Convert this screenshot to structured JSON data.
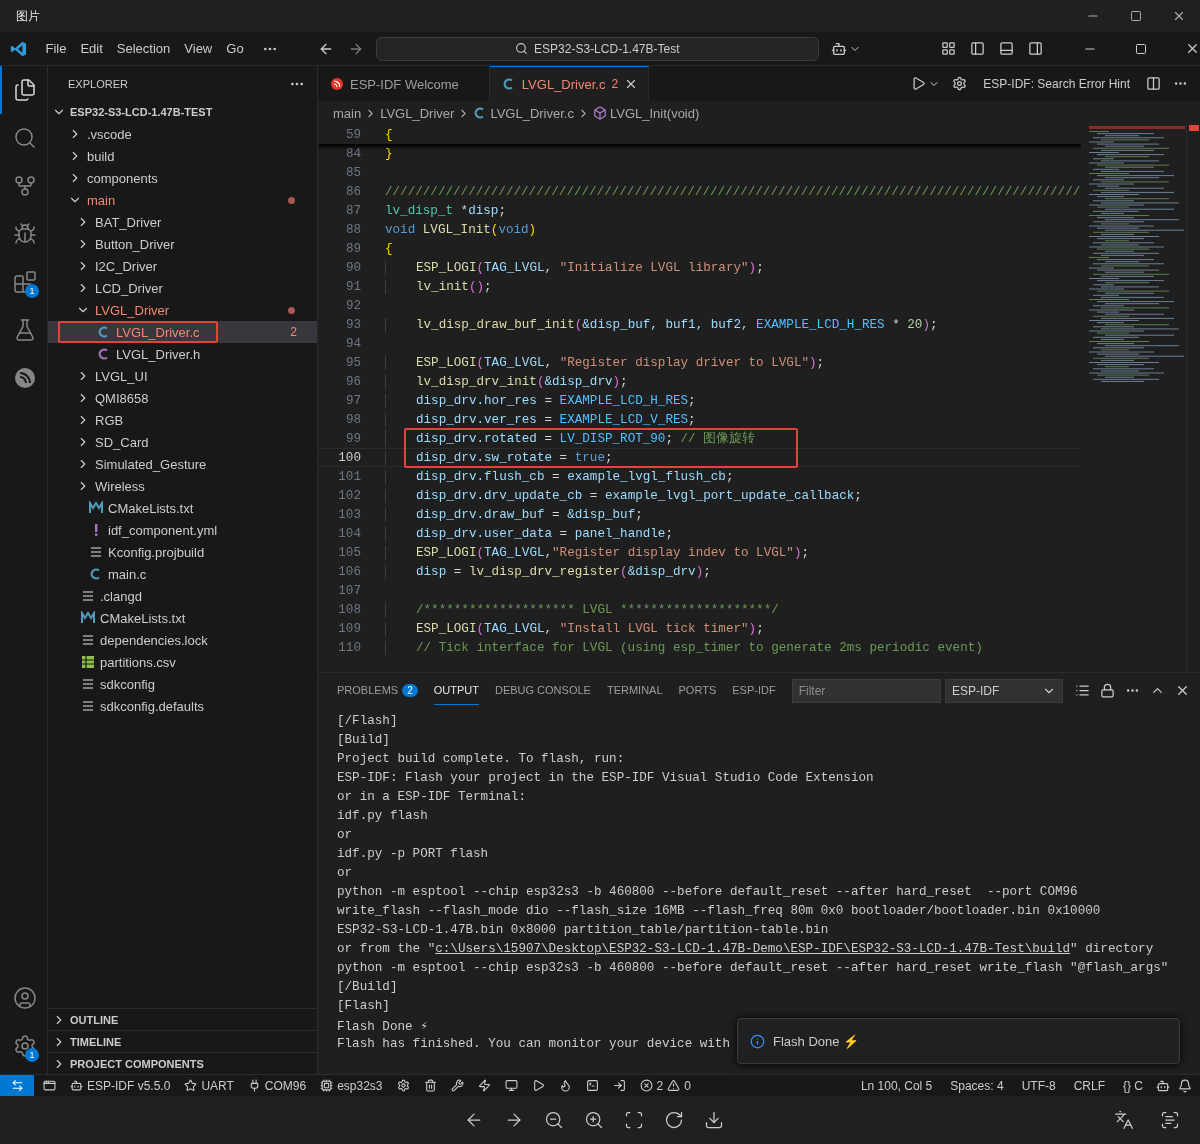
{
  "viewer": {
    "title": "图片"
  },
  "titlebar": {
    "menus": [
      "File",
      "Edit",
      "Selection",
      "View",
      "Go"
    ],
    "search": "ESP32-S3-LCD-1.47B-Test"
  },
  "activity": [
    {
      "kind": "explorer",
      "selected": true
    },
    {
      "kind": "search",
      "selected": false
    },
    {
      "kind": "source-control",
      "selected": false
    },
    {
      "kind": "run-debug",
      "selected": false
    },
    {
      "kind": "extensions",
      "selected": false,
      "badge": "1"
    },
    {
      "kind": "testing",
      "selected": false
    },
    {
      "kind": "espressif",
      "selected": false
    }
  ],
  "activity_bottom": [
    {
      "kind": "account",
      "selected": false
    },
    {
      "kind": "settings",
      "selected": false,
      "badge": "1"
    }
  ],
  "sidebar": {
    "title": "EXPLORER",
    "root": "ESP32-S3-LCD-1.47B-TEST",
    "items": [
      {
        "label": ".vscode",
        "kind": "folder",
        "expanded": false
      },
      {
        "label": "build",
        "kind": "folder",
        "expanded": false
      },
      {
        "label": "components",
        "kind": "folder",
        "expanded": false
      },
      {
        "label": "main",
        "kind": "folder",
        "expanded": true,
        "error": true,
        "children": [
          {
            "label": "BAT_Driver",
            "kind": "folder",
            "expanded": false
          },
          {
            "label": "Button_Driver",
            "kind": "folder",
            "expanded": false
          },
          {
            "label": "I2C_Driver",
            "kind": "folder",
            "expanded": false
          },
          {
            "label": "LCD_Driver",
            "kind": "folder",
            "expanded": false
          },
          {
            "label": "LVGL_Driver",
            "kind": "folder",
            "expanded": true,
            "error": true,
            "children": [
              {
                "label": "LVGL_Driver.c",
                "kind": "c",
                "selected": true,
                "error": true,
                "badge": "2",
                "boxed": true
              },
              {
                "label": "LVGL_Driver.h",
                "kind": "h",
                "selected": false
              }
            ]
          },
          {
            "label": "LVGL_UI",
            "kind": "folder",
            "expanded": false
          },
          {
            "label": "QMI8658",
            "kind": "folder",
            "expanded": false
          },
          {
            "label": "RGB",
            "kind": "folder",
            "expanded": false
          },
          {
            "label": "SD_Card",
            "kind": "folder",
            "expanded": false
          },
          {
            "label": "Simulated_Gesture",
            "kind": "folder",
            "expanded": false
          },
          {
            "label": "Wireless",
            "kind": "folder",
            "expanded": false
          },
          {
            "label": "CMakeLists.txt",
            "kind": "cmake",
            "selected": false
          },
          {
            "label": "idf_component.yml",
            "kind": "yaml",
            "selected": false
          },
          {
            "label": "Kconfig.projbuild",
            "kind": "lines",
            "selected": false
          },
          {
            "label": "main.c",
            "kind": "c",
            "selected": false
          }
        ]
      },
      {
        "label": ".clangd",
        "kind": "lines",
        "selected": false
      },
      {
        "label": "CMakeLists.txt",
        "kind": "cmake",
        "selected": false
      },
      {
        "label": "dependencies.lock",
        "kind": "lines",
        "selected": false
      },
      {
        "label": "partitions.csv",
        "kind": "csv",
        "selected": false
      },
      {
        "label": "sdkconfig",
        "kind": "lines",
        "selected": false
      },
      {
        "label": "sdkconfig.defaults",
        "kind": "lines",
        "selected": false
      }
    ],
    "sections": [
      "OUTLINE",
      "TIMELINE",
      "PROJECT COMPONENTS"
    ]
  },
  "tabs": [
    {
      "label": "ESP-IDF Welcome",
      "kind": "espressif",
      "selected": false
    },
    {
      "label": "LVGL_Driver.c",
      "kind": "c",
      "selected": true,
      "error": true,
      "badge": "2"
    }
  ],
  "editor_actions": {
    "hint": "ESP-IDF: Search Error Hint"
  },
  "breadcrumb": [
    {
      "label": "main",
      "kind": "folder"
    },
    {
      "label": "LVGL_Driver",
      "kind": "folder"
    },
    {
      "label": "LVGL_Driver.c",
      "kind": "c"
    },
    {
      "label": "LVGL_Init(void)",
      "kind": "function"
    }
  ],
  "sticky": {
    "num": "59",
    "tokens": [
      {
        "text": "{",
        "kind": "brace"
      }
    ]
  },
  "code": [
    {
      "num": "84",
      "tokens": [
        {
          "text": "}",
          "kind": "brace"
        }
      ]
    },
    {
      "num": "85"
    },
    {
      "num": "86",
      "tokens": [
        {
          "text": "////////////////////////////////////////////////////////////////////////////////////////////",
          "kind": "com"
        }
      ]
    },
    {
      "num": "87",
      "tokens": [
        {
          "text": "lv_disp_t",
          "kind": "type"
        },
        {
          "text": " *",
          "kind": "op"
        },
        {
          "text": "disp",
          "kind": "var"
        },
        {
          "text": ";",
          "kind": "op"
        }
      ]
    },
    {
      "num": "88",
      "tokens": [
        {
          "text": "void",
          "kind": "kw"
        },
        {
          "text": " LVGL_Init",
          "kind": "fn"
        },
        {
          "text": "(",
          "kind": "brace"
        },
        {
          "text": "void",
          "kind": "kw"
        },
        {
          "text": ")",
          "kind": "brace"
        }
      ]
    },
    {
      "num": "89",
      "tokens": [
        {
          "text": "{",
          "kind": "brace"
        }
      ]
    },
    {
      "num": "90",
      "indented": true,
      "tokens": [
        {
          "text": "ESP_LOGI",
          "kind": "fn"
        },
        {
          "text": "(",
          "kind": "paren"
        },
        {
          "text": "TAG_LVGL",
          "kind": "var"
        },
        {
          "text": ", ",
          "kind": "op"
        },
        {
          "text": "\"Initialize LVGL library\"",
          "kind": "str"
        },
        {
          "text": ")",
          "kind": "paren"
        },
        {
          "text": ";",
          "kind": "op"
        }
      ]
    },
    {
      "num": "91",
      "indented": true,
      "tokens": [
        {
          "text": "lv_init",
          "kind": "fn"
        },
        {
          "text": "()",
          "kind": "paren"
        },
        {
          "text": ";",
          "kind": "op"
        }
      ]
    },
    {
      "num": "92"
    },
    {
      "num": "93",
      "indented": true,
      "tokens": [
        {
          "text": "lv_disp_draw_buf_init",
          "kind": "fn"
        },
        {
          "text": "(",
          "kind": "paren"
        },
        {
          "text": "&disp_buf, buf1, buf2, ",
          "kind": "var"
        },
        {
          "text": "EXAMPLE_LCD_H_RES",
          "kind": "mac"
        },
        {
          "text": " * ",
          "kind": "op"
        },
        {
          "text": "20",
          "kind": "num"
        },
        {
          "text": ")",
          "kind": "paren"
        },
        {
          "text": ";",
          "kind": "op"
        }
      ]
    },
    {
      "num": "94"
    },
    {
      "num": "95",
      "indented": true,
      "tokens": [
        {
          "text": "ESP_LOGI",
          "kind": "fn"
        },
        {
          "text": "(",
          "kind": "paren"
        },
        {
          "text": "TAG_LVGL",
          "kind": "var"
        },
        {
          "text": ", ",
          "kind": "op"
        },
        {
          "text": "\"Register display driver to LVGL\"",
          "kind": "str"
        },
        {
          "text": ")",
          "kind": "paren"
        },
        {
          "text": ";",
          "kind": "op"
        }
      ]
    },
    {
      "num": "96",
      "indented": true,
      "tokens": [
        {
          "text": "lv_disp_drv_init",
          "kind": "fn"
        },
        {
          "text": "(",
          "kind": "paren"
        },
        {
          "text": "&disp_drv",
          "kind": "var"
        },
        {
          "text": ")",
          "kind": "paren"
        },
        {
          "text": ";",
          "kind": "op"
        }
      ]
    },
    {
      "num": "97",
      "indented": true,
      "tokens": [
        {
          "text": "disp_drv.hor_res",
          "kind": "var"
        },
        {
          "text": " = ",
          "kind": "op"
        },
        {
          "text": "EXAMPLE_LCD_H_RES",
          "kind": "mac"
        },
        {
          "text": ";",
          "kind": "op"
        }
      ]
    },
    {
      "num": "98",
      "indented": true,
      "tokens": [
        {
          "text": "disp_drv.ver_res",
          "kind": "var"
        },
        {
          "text": " = ",
          "kind": "op"
        },
        {
          "text": "EXAMPLE_LCD_V_RES",
          "kind": "mac"
        },
        {
          "text": ";",
          "kind": "op"
        }
      ]
    },
    {
      "num": "99",
      "indented": true,
      "boxed": true,
      "tokens": [
        {
          "text": "disp_drv.rotated",
          "kind": "var"
        },
        {
          "text": " = ",
          "kind": "op"
        },
        {
          "text": "LV_DISP_ROT_90",
          "kind": "mac"
        },
        {
          "text": "; ",
          "kind": "op"
        },
        {
          "text": "// 图像旋转",
          "kind": "com"
        }
      ]
    },
    {
      "num": "100",
      "indented": true,
      "boxed": true,
      "current": true,
      "tokens": [
        {
          "text": "disp_drv.sw_rotate",
          "kind": "var"
        },
        {
          "text": " = ",
          "kind": "op"
        },
        {
          "text": "true",
          "kind": "kw"
        },
        {
          "text": ";",
          "kind": "op"
        }
      ]
    },
    {
      "num": "101",
      "indented": true,
      "tokens": [
        {
          "text": "disp_drv.flush_cb",
          "kind": "var"
        },
        {
          "text": " = ",
          "kind": "op"
        },
        {
          "text": "example_lvgl_flush_cb",
          "kind": "var"
        },
        {
          "text": ";",
          "kind": "op"
        }
      ]
    },
    {
      "num": "102",
      "indented": true,
      "tokens": [
        {
          "text": "disp_drv.drv_update_cb",
          "kind": "var"
        },
        {
          "text": " = ",
          "kind": "op"
        },
        {
          "text": "example_lvgl_port_update_callback",
          "kind": "var"
        },
        {
          "text": ";",
          "kind": "op"
        }
      ]
    },
    {
      "num": "103",
      "indented": true,
      "tokens": [
        {
          "text": "disp_drv.draw_buf",
          "kind": "var"
        },
        {
          "text": " = ",
          "kind": "op"
        },
        {
          "text": "&disp_buf",
          "kind": "var"
        },
        {
          "text": ";",
          "kind": "op"
        }
      ]
    },
    {
      "num": "104",
      "indented": true,
      "tokens": [
        {
          "text": "disp_drv.user_data",
          "kind": "var"
        },
        {
          "text": " = ",
          "kind": "op"
        },
        {
          "text": "panel_handle",
          "kind": "var"
        },
        {
          "text": ";",
          "kind": "op"
        }
      ]
    },
    {
      "num": "105",
      "indented": true,
      "tokens": [
        {
          "text": "ESP_LOGI",
          "kind": "fn"
        },
        {
          "text": "(",
          "kind": "paren"
        },
        {
          "text": "TAG_LVGL",
          "kind": "var"
        },
        {
          "text": ",",
          "kind": "op"
        },
        {
          "text": "\"Register display indev to LVGL\"",
          "kind": "str"
        },
        {
          "text": ")",
          "kind": "paren"
        },
        {
          "text": ";",
          "kind": "op"
        }
      ]
    },
    {
      "num": "106",
      "indented": true,
      "tokens": [
        {
          "text": "disp",
          "kind": "var"
        },
        {
          "text": " = ",
          "kind": "op"
        },
        {
          "text": "lv_disp_drv_register",
          "kind": "fn"
        },
        {
          "text": "(",
          "kind": "paren"
        },
        {
          "text": "&disp_drv",
          "kind": "var"
        },
        {
          "text": ")",
          "kind": "paren"
        },
        {
          "text": ";",
          "kind": "op"
        }
      ]
    },
    {
      "num": "107"
    },
    {
      "num": "108",
      "indented": true,
      "tokens": [
        {
          "text": "/******************** LVGL ********************/",
          "kind": "com"
        }
      ]
    },
    {
      "num": "109",
      "indented": true,
      "tokens": [
        {
          "text": "ESP_LOGI",
          "kind": "fn"
        },
        {
          "text": "(",
          "kind": "paren"
        },
        {
          "text": "TAG_LVGL",
          "kind": "var"
        },
        {
          "text": ", ",
          "kind": "op"
        },
        {
          "text": "\"Install LVGL tick timer\"",
          "kind": "str"
        },
        {
          "text": ")",
          "kind": "paren"
        },
        {
          "text": ";",
          "kind": "op"
        }
      ]
    },
    {
      "num": "110",
      "indented": true,
      "tokens": [
        {
          "text": "// Tick interface for LVGL (using esp_timer to generate 2ms periodic event)",
          "kind": "com"
        }
      ]
    }
  ],
  "panel": {
    "tabs": [
      {
        "label": "PROBLEMS",
        "selected": false,
        "badge": "2"
      },
      {
        "label": "OUTPUT",
        "selected": true
      },
      {
        "label": "DEBUG CONSOLE",
        "selected": false
      },
      {
        "label": "TERMINAL",
        "selected": false
      },
      {
        "label": "PORTS",
        "selected": false
      },
      {
        "label": "ESP-IDF",
        "selected": false
      }
    ],
    "filter_placeholder": "Filter",
    "channel": "ESP-IDF",
    "output": [
      {
        "text": "[/Flash]"
      },
      {
        "text": "[Build]"
      },
      {
        "text": "Project build complete. To flash, run:"
      },
      {
        "text": "ESP-IDF: Flash your project in the ESP-IDF Visual Studio Code Extension"
      },
      {
        "text": "or in a ESP-IDF Terminal:"
      },
      {
        "text": "idf.py flash"
      },
      {
        "text": "or"
      },
      {
        "text": "idf.py -p PORT flash"
      },
      {
        "text": "or"
      },
      {
        "text": "python -m esptool --chip esp32s3 -b 460800 --before default_reset --after hard_reset  --port COM96"
      },
      {
        "text": "write_flash --flash_mode dio --flash_size 16MB --flash_freq 80m 0x0 bootloader/bootloader.bin 0x10000"
      },
      {
        "text": "ESP32-S3-LCD-1.47B.bin 0x8000 partition_table/partition-table.bin"
      },
      {
        "before": "or from the \"",
        "link": "c:\\Users\\15907\\Desktop\\ESP32-S3-LCD-1.47B-Demo\\ESP-IDF\\ESP32-S3-LCD-1.47B-Test\\build",
        "after": "\" directory"
      },
      {
        "text": "python -m esptool --chip esp32s3 -b 460800 --before default_reset --after hard_reset write_flash \"@flash_args\""
      },
      {
        "text": "[/Build]"
      },
      {
        "text": "[Flash]"
      },
      {
        "text": "Flash Done ⚡"
      },
      {
        "text": "Flash has finished. You can monitor your device with"
      }
    ],
    "toast": "Flash Done ⚡"
  },
  "status": {
    "left": [
      {
        "kind": "bot",
        "text": "ESP-IDF v5.5.0"
      },
      {
        "kind": "star",
        "text": "UART"
      },
      {
        "kind": "plug",
        "text": "COM96"
      },
      {
        "kind": "chip",
        "text": "esp32s3"
      }
    ],
    "problems": {
      "errors": "2",
      "warnings": "0"
    },
    "right": [
      "Ln 100, Col 5",
      "Spaces: 4",
      "UTF-8",
      "CRLF",
      "{} C"
    ]
  }
}
